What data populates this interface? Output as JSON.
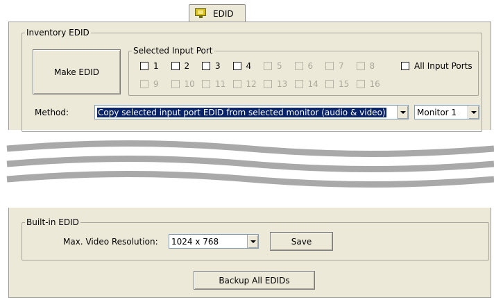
{
  "tab": {
    "label": "EDID",
    "icon": "monitor-icon"
  },
  "inventory": {
    "legend": "Inventory EDID",
    "make_button": "Make EDID",
    "selected_port_legend": "Selected Input Port",
    "ports_row1": [
      "1",
      "2",
      "3",
      "4",
      "5",
      "6",
      "7",
      "8"
    ],
    "ports_row2": [
      "9",
      "10",
      "11",
      "12",
      "13",
      "14",
      "15",
      "16"
    ],
    "all_ports_label": "All Input Ports",
    "method_label": "Method:",
    "method_value": "Copy selected input port EDID from selected monitor (audio & video)",
    "monitor_value": "Monitor 1"
  },
  "builtin": {
    "legend": "Built-in EDID",
    "resolution_label": "Max. Video Resolution:",
    "resolution_value": "1024 x 768",
    "save_button": "Save"
  },
  "backup_button": "Backup All EDIDs",
  "colors": {
    "panel": "#ECE9D8",
    "selection": "#0A246A",
    "wave": "#A9A9A9"
  }
}
